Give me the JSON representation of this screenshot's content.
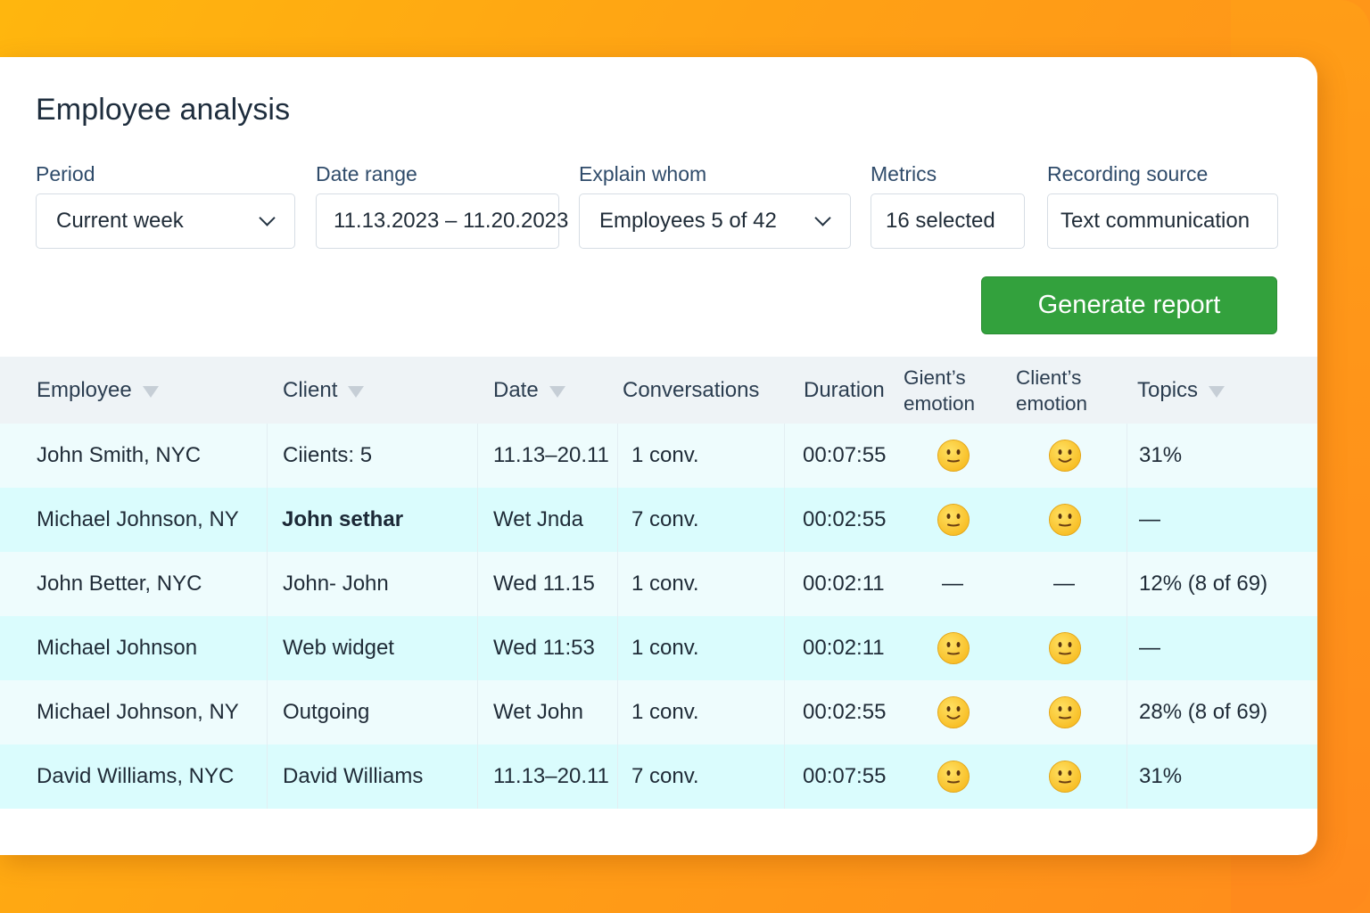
{
  "title": "Employee analysis",
  "filters": [
    {
      "label": "Period",
      "value": "Current week",
      "dropdown": true
    },
    {
      "label": "Date range",
      "value": "11.13.2023 – 11.20.2023",
      "dropdown": false
    },
    {
      "label": "Explain whom",
      "value": "Employees 5 of 42",
      "dropdown": true
    },
    {
      "label": "Metrics",
      "value": "16 selected",
      "dropdown": false
    },
    {
      "label": "Recording source",
      "value": "Text communication",
      "dropdown": false
    }
  ],
  "generate_label": "Generate report",
  "columns": {
    "employee": "Employee",
    "client": "Client",
    "date": "Date",
    "conversations": "Conversations",
    "duration": "Duration",
    "agent_emotion_1": "Gient’s",
    "agent_emotion_2": "emotion",
    "client_emotion_1": "Client’s",
    "client_emotion_2": "emotion",
    "topics": "Topics"
  },
  "rows": [
    {
      "employee": "John Smith, NYC",
      "client": "Ciients: 5",
      "client_bold": false,
      "date": "11.13–20.11",
      "conversations": "1 conv.",
      "duration": "00:07:55",
      "agent_emotion": "neutral-face",
      "client_emotion": "slight-smile",
      "topics": "31%"
    },
    {
      "employee": "Michael Johnson, NY",
      "client": "John sethar",
      "client_bold": true,
      "date": "Wet Jnda",
      "conversations": "7 conv.",
      "duration": "00:02:55",
      "agent_emotion": "neutral-face",
      "client_emotion": "neutral-face",
      "topics": "—"
    },
    {
      "employee": "John Better, NYC",
      "client": "John- John",
      "client_bold": false,
      "date": "Wed 11.15",
      "conversations": "1 conv.",
      "duration": "00:02:11",
      "agent_emotion": "—",
      "client_emotion": "—",
      "topics": "12% (8 of 69)"
    },
    {
      "employee": "Michael Johnson",
      "client": "Web widget",
      "client_bold": false,
      "date": "Wed 11:53",
      "conversations": "1 conv.",
      "duration": "00:02:11",
      "agent_emotion": "neutral-face",
      "client_emotion": "neutral-face",
      "topics": "—"
    },
    {
      "employee": "Michael Johnson, NY",
      "client": "Outgoing",
      "client_bold": false,
      "date": "Wet John",
      "conversations": "1 conv.",
      "duration": "00:02:55",
      "agent_emotion": "slight-smile",
      "client_emotion": "neutral-face",
      "topics": "28% (8 of 69)"
    },
    {
      "employee": "David Williams, NYC",
      "client": "David Williams",
      "client_bold": false,
      "date": "11.13–20.11",
      "conversations": "7 conv.",
      "duration": "00:07:55",
      "agent_emotion": "neutral-face",
      "client_emotion": "neutral-face",
      "topics": "31%"
    }
  ],
  "colors": {
    "accent_green": "#33a13d",
    "background_orange": "#ffa015",
    "row_light": "#eefcfd",
    "row_cyan": "#dafcfd",
    "emoji_yellow": "#ffce3a"
  }
}
